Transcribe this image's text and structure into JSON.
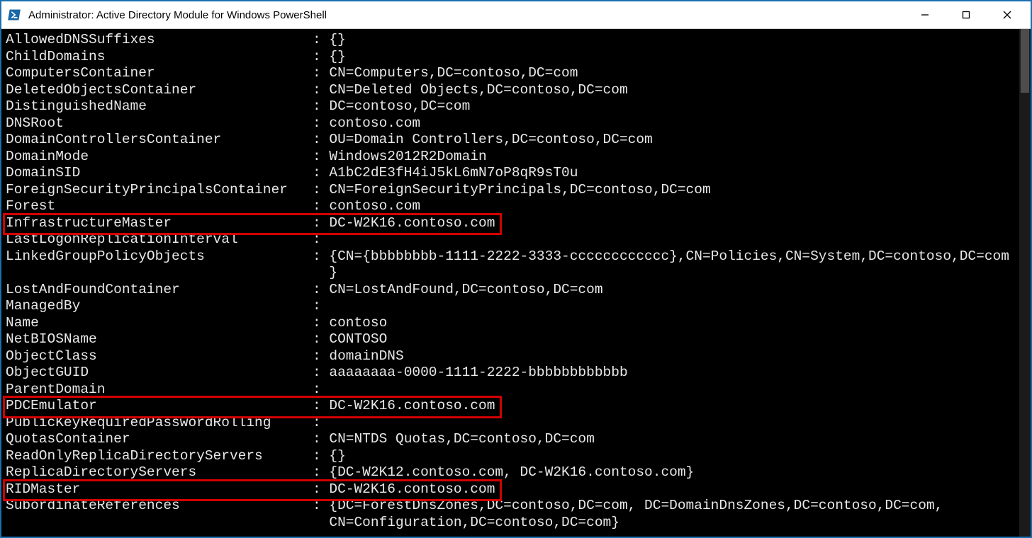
{
  "window": {
    "title": "Administrator: Active Directory Module for Windows PowerShell"
  },
  "layout": {
    "key_col_chars": 36,
    "sep": " : "
  },
  "highlight_rows": [
    "InfrastructureMaster",
    "PDCEmulator",
    "RIDMaster"
  ],
  "rows": [
    {
      "key": "AllowedDNSSuffixes",
      "value": "{}"
    },
    {
      "key": "ChildDomains",
      "value": "{}"
    },
    {
      "key": "ComputersContainer",
      "value": "CN=Computers,DC=contoso,DC=com"
    },
    {
      "key": "DeletedObjectsContainer",
      "value": "CN=Deleted Objects,DC=contoso,DC=com"
    },
    {
      "key": "DistinguishedName",
      "value": "DC=contoso,DC=com"
    },
    {
      "key": "DNSRoot",
      "value": "contoso.com"
    },
    {
      "key": "DomainControllersContainer",
      "value": "OU=Domain Controllers,DC=contoso,DC=com"
    },
    {
      "key": "DomainMode",
      "value": "Windows2012R2Domain"
    },
    {
      "key": "DomainSID",
      "value": "A1bC2dE3fH4iJ5kL6mN7oP8qR9sT0u"
    },
    {
      "key": "ForeignSecurityPrincipalsContainer",
      "value": "CN=ForeignSecurityPrincipals,DC=contoso,DC=com"
    },
    {
      "key": "Forest",
      "value": "contoso.com"
    },
    {
      "key": "InfrastructureMaster",
      "value": "DC-W2K16.contoso.com"
    },
    {
      "key": "LastLogonReplicationInterval",
      "value": ""
    },
    {
      "key": "LinkedGroupPolicyObjects",
      "value": "{CN={bbbbbbbb-1111-2222-3333-cccccccccccc},CN=Policies,CN=System,DC=contoso,DC=com",
      "cont": [
        "}"
      ]
    },
    {
      "key": "LostAndFoundContainer",
      "value": "CN=LostAndFound,DC=contoso,DC=com"
    },
    {
      "key": "ManagedBy",
      "value": ""
    },
    {
      "key": "Name",
      "value": "contoso"
    },
    {
      "key": "NetBIOSName",
      "value": "CONTOSO"
    },
    {
      "key": "ObjectClass",
      "value": "domainDNS"
    },
    {
      "key": "ObjectGUID",
      "value": "aaaaaaaa-0000-1111-2222-bbbbbbbbbbbb"
    },
    {
      "key": "ParentDomain",
      "value": ""
    },
    {
      "key": "PDCEmulator",
      "value": "DC-W2K16.contoso.com"
    },
    {
      "key": "PublicKeyRequiredPasswordRolling",
      "value": ""
    },
    {
      "key": "QuotasContainer",
      "value": "CN=NTDS Quotas,DC=contoso,DC=com"
    },
    {
      "key": "ReadOnlyReplicaDirectoryServers",
      "value": "{}"
    },
    {
      "key": "ReplicaDirectoryServers",
      "value": "{DC-W2K12.contoso.com, DC-W2K16.contoso.com}"
    },
    {
      "key": "RIDMaster",
      "value": "DC-W2K16.contoso.com"
    },
    {
      "key": "SubordinateReferences",
      "value": "{DC=ForestDnsZones,DC=contoso,DC=com, DC=DomainDnsZones,DC=contoso,DC=com,",
      "cont": [
        "CN=Configuration,DC=contoso,DC=com}"
      ]
    }
  ]
}
